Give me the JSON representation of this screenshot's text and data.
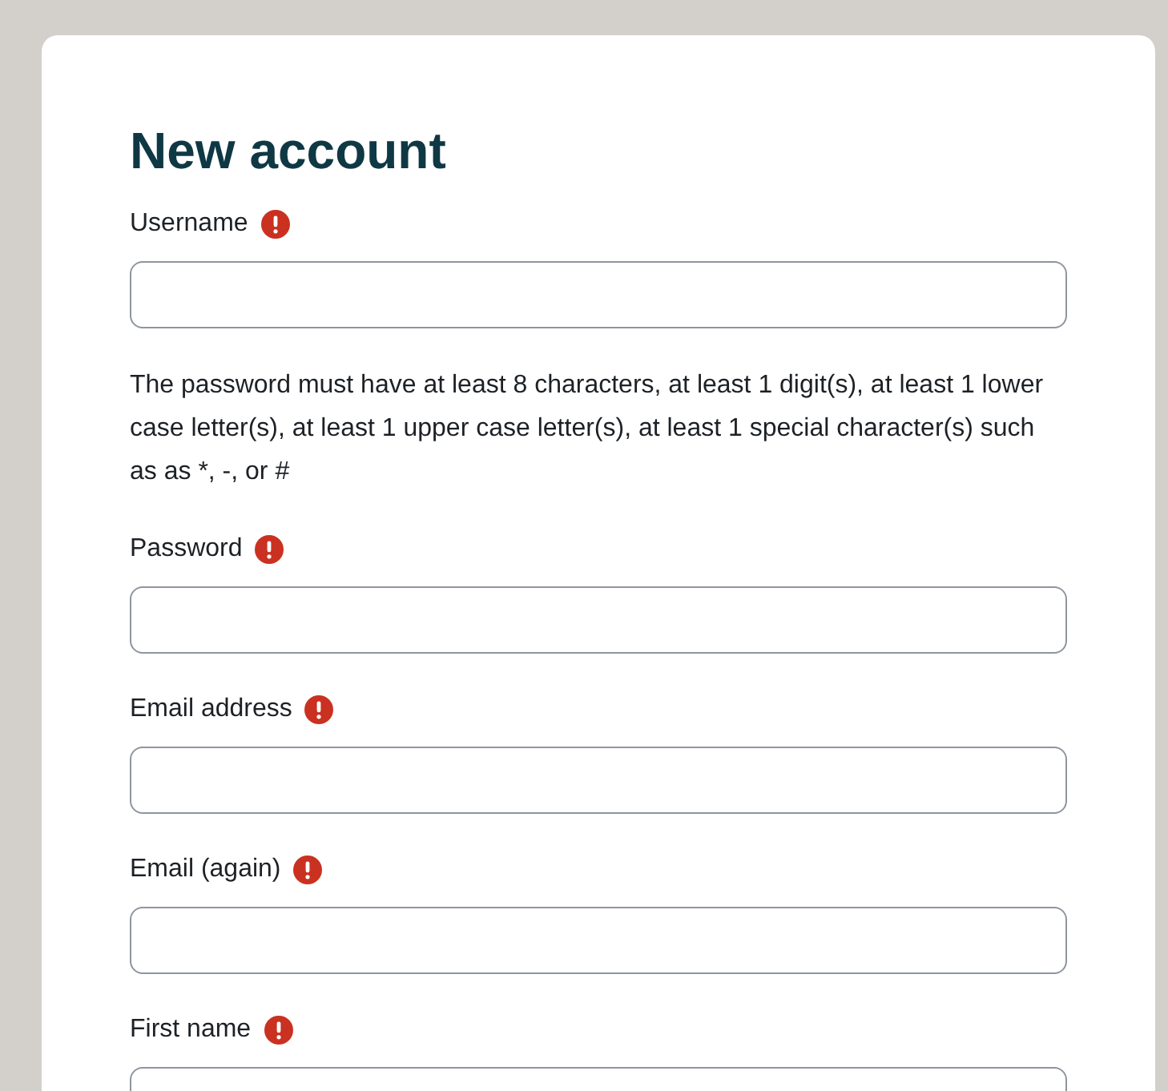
{
  "title": "New account",
  "form": [
    {
      "kind": "field",
      "label": "Username",
      "required": true
    },
    {
      "kind": "note",
      "text": "The password must have at least 8 characters, at least 1 digit(s), at least 1 lower case letter(s), at least 1 upper case letter(s), at least 1 special character(s) such as as *, -, or #"
    },
    {
      "kind": "field",
      "label": "Password",
      "required": true
    },
    {
      "kind": "field",
      "label": "Email address",
      "required": true
    },
    {
      "kind": "field",
      "label": "Email (again)",
      "required": true
    },
    {
      "kind": "field",
      "label": "First name",
      "required": true
    }
  ]
}
